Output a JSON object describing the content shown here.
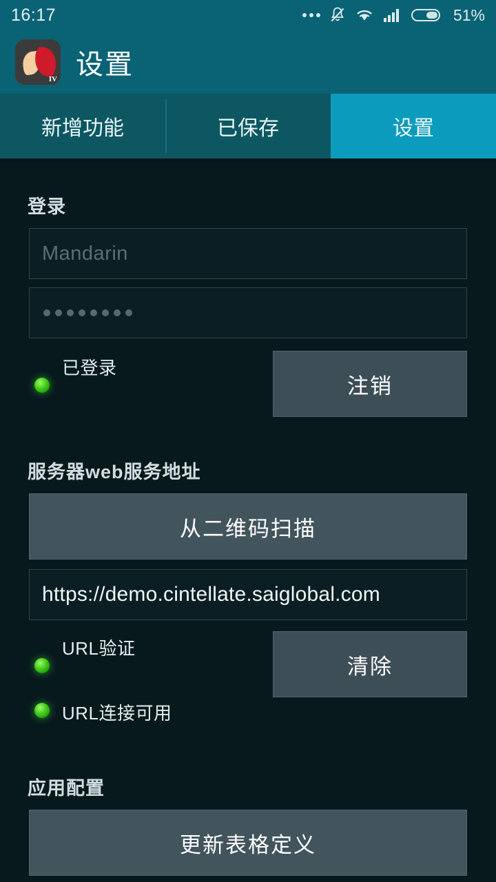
{
  "status_bar": {
    "time": "16:17",
    "battery_percent": "51%",
    "icons": [
      "more-dots-icon",
      "mute-bell-icon",
      "wifi-icon",
      "signal-bars-icon",
      "battery-icon"
    ]
  },
  "app_bar": {
    "title": "设置",
    "logo_badge": "IV"
  },
  "tabs": [
    {
      "label": "新增功能",
      "active": false
    },
    {
      "label": "已保存",
      "active": false
    },
    {
      "label": "设置",
      "active": true
    }
  ],
  "login_section": {
    "title": "登录",
    "username_value": "Mandarin",
    "password_mask": "••••••••",
    "password_dot_count": 8,
    "status_label": "已登录",
    "status_led_color": "#4ed321",
    "logout_button": "注销"
  },
  "server_section": {
    "title": "服务器web服务地址",
    "scan_button": "从二维码扫描",
    "url_value": "https://demo.cintellate.saiglobal.com",
    "validation_label": "URL验证",
    "validation_led_color": "#4ed321",
    "connection_label": "URL连接可用",
    "connection_led_color": "#4ed321",
    "clear_button": "清除"
  },
  "app_config_section": {
    "title": "应用配置",
    "update_forms_button": "更新表格定义"
  },
  "theme": {
    "header_teal": "#0a6275",
    "tab_inactive": "#0d5762",
    "tab_active": "#0b9cbd",
    "page_background": "#08191e",
    "button_slate": "#3e4e56"
  }
}
